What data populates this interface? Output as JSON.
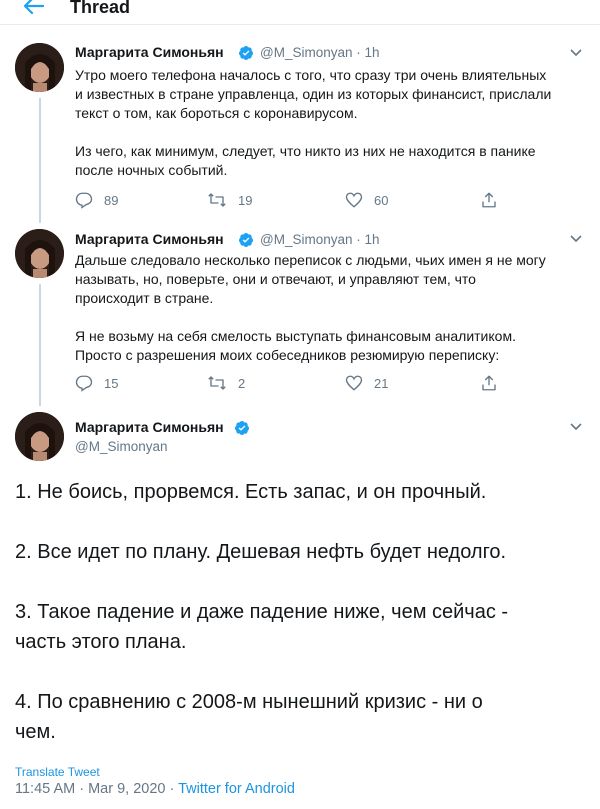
{
  "header": {
    "title": "Thread"
  },
  "author": {
    "name": "Маргарита Симоньян",
    "handle": "@M_Simonyan"
  },
  "tweets": [
    {
      "time": "1h",
      "text": "Утро моего телефона началось с того, что сразу три очень влиятельных\nи известных в стране управленца, один из которых финансист, прислали\nтекст о том, как бороться с коронавирусом.\n\nИз чего, как минимум, следует, что никто из них не находится в панике\nпосле ночных событий.",
      "replies": "89",
      "retweets": "19",
      "likes": "60"
    },
    {
      "time": "1h",
      "text": "Дальше следовало несколько переписок с людьми, чьих имен я не могу\nназывать, но, поверьте, они и отвечают, и управляют тем, что\nпроисходит в стране.\n\nЯ не возьму на себя смелость выступать финансовым аналитиком.\nПросто с разрешения моих собеседников резюмирую переписку:",
      "replies": "15",
      "retweets": "2",
      "likes": "21"
    }
  ],
  "main_tweet": {
    "text": "1. Не боись, прорвемся. Есть запас, и он прочный.\n\n2. Все идет по плану. Дешевая нефть будет недолго.\n\n3. Такое падение и даже падение ниже, чем сейчас -\nчасть этого плана.\n\n4. По сравнению с 2008-м нынешний кризис - ни о\nчем.",
    "translate_label": "Translate Tweet",
    "timestamp": "11:45 AM · Mar 9, 2020 · ",
    "source": "Twitter for Android"
  },
  "icons": {
    "back": "back-arrow-icon",
    "verified": "verified-badge-icon",
    "more": "chevron-down-icon",
    "reply": "reply-icon",
    "retweet": "retweet-icon",
    "like": "heart-icon",
    "share": "share-icon"
  },
  "colors": {
    "accent": "#1da1f2",
    "link": "#1b95e0",
    "secondary_text": "#657786",
    "thread_line": "#ccd6dd"
  }
}
